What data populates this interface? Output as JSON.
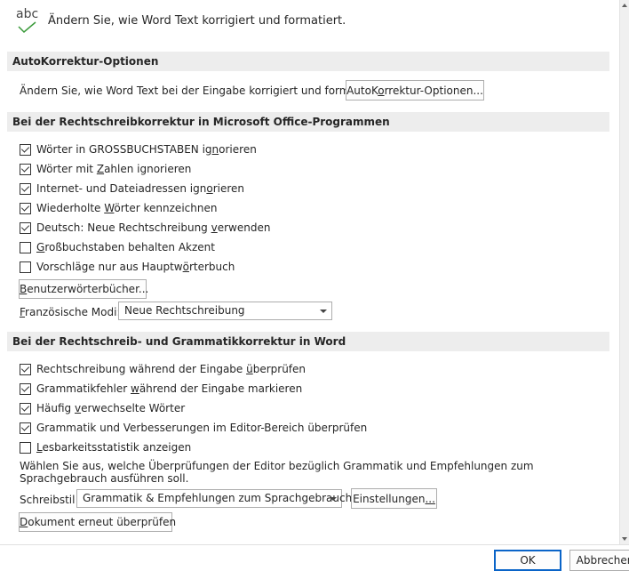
{
  "header": {
    "icon_text": "abc",
    "title": "Ändern Sie, wie Word Text korrigiert und formatiert."
  },
  "autocorrect": {
    "section_title": "AutoKorrektur-Optionen",
    "description": "Ändern Sie, wie Word Text bei der Eingabe korrigiert und formatiert:",
    "button_pre": "AutoK",
    "button_ul": "o",
    "button_post": "rrektur-Optionen..."
  },
  "office": {
    "section_title": "Bei der Rechtschreibkorrektur in Microsoft Office-Programmen",
    "options": [
      {
        "pre": "Wörter in GROSSBUCHSTABEN ig",
        "ul": "n",
        "post": "orieren",
        "checked": true
      },
      {
        "pre": "Wörter mit ",
        "ul": "Z",
        "post": "ahlen ignorieren",
        "checked": true
      },
      {
        "pre": "Internet- und Dateiadressen ign",
        "ul": "o",
        "post": "rieren",
        "checked": true
      },
      {
        "pre": "Wiederholte ",
        "ul": "W",
        "post": "örter kennzeichnen",
        "checked": true
      },
      {
        "pre": "Deutsch: Neue Rechtschreibung ",
        "ul": "v",
        "post": "erwenden",
        "checked": true
      },
      {
        "pre": "",
        "ul": "G",
        "post": "roßbuchstaben behalten Akzent",
        "checked": false
      },
      {
        "pre": "Vorschläge nur aus Hauptw",
        "ul": "ö",
        "post": "rterbuch",
        "checked": false
      }
    ],
    "dict_button_pre": "",
    "dict_button_ul": "B",
    "dict_button_post": "enutzerwörterbücher...",
    "french_label_pre": "",
    "french_label_ul": "F",
    "french_label_post": "ranzösische Modi:",
    "french_value": "Neue Rechtschreibung"
  },
  "word": {
    "section_title": "Bei der Rechtschreib- und Grammatikkorrektur in Word",
    "options": [
      {
        "pre": "Rechtschreibung während der Eingabe ",
        "ul": "ü",
        "post": "berprüfen",
        "checked": true
      },
      {
        "pre": "Grammatikfehler ",
        "ul": "w",
        "post": "ährend der Eingabe markieren",
        "checked": true
      },
      {
        "pre": "Häufig ",
        "ul": "v",
        "post": "erwechselte Wörter",
        "checked": true
      },
      {
        "pre": "Grammatik und Verbesserungen im Editor-Bereich überprüfen",
        "ul": "",
        "post": "",
        "checked": true
      },
      {
        "pre": "",
        "ul": "L",
        "post": "esbarkeitsstatistik anzeigen",
        "checked": false
      }
    ],
    "info_text": "Wählen Sie aus, welche Überprüfungen der Editor bezüglich Grammatik und Empfehlungen zum Sprachgebrauch ausführen soll.",
    "style_label": "Schreibstil",
    "style_value": "Grammatik & Empfehlungen zum Sprachgebrauch",
    "settings_button_pre": "Einstellungen",
    "settings_button_ul": "...",
    "recheck_button_pre": "",
    "recheck_button_ul": "D",
    "recheck_button_post": "okument erneut überprüfen"
  },
  "footer": {
    "ok": "OK",
    "cancel": "Abbrechen"
  },
  "colors": {
    "section_bg": "#ededed",
    "check_icon_green": "#3a9a3a",
    "ok_border": "#0a64c8"
  }
}
